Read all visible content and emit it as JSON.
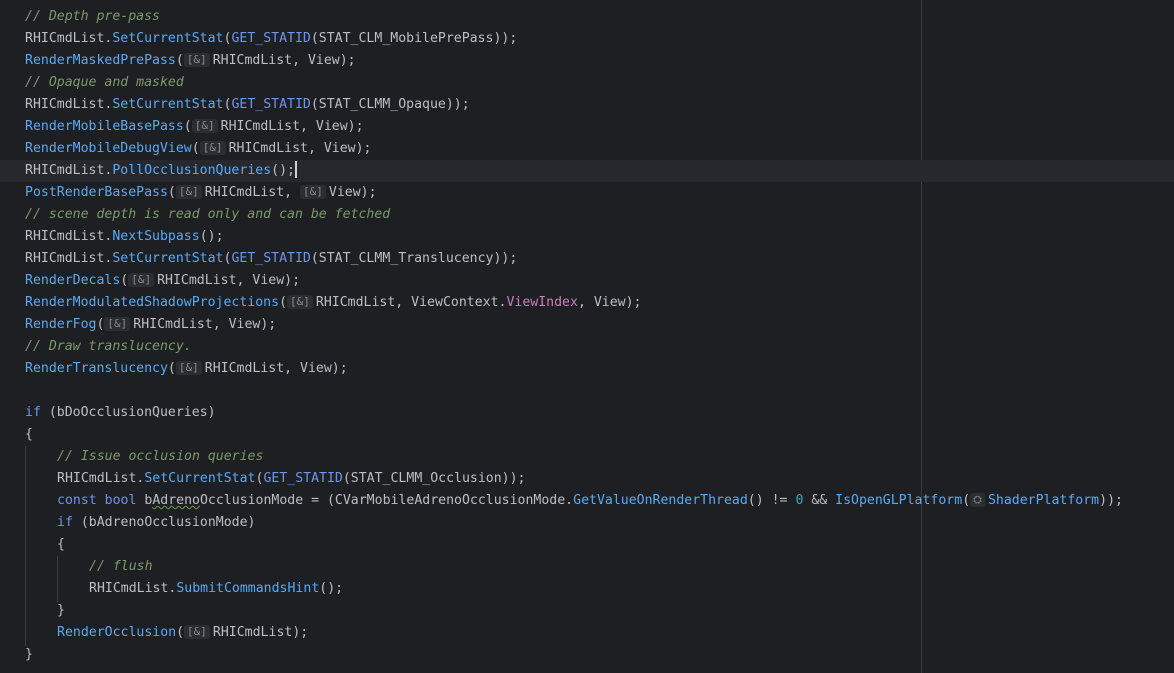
{
  "editor": {
    "hints": {
      "ref": "[&]",
      "shader": "⛭"
    },
    "lines": {
      "l1": "// Depth pre-pass",
      "l2": [
        "RHICmdList.",
        "SetCurrentStat",
        "(",
        "GET_STATID",
        "(STAT_CLM_MobilePrePass));"
      ],
      "l3": [
        "RenderMaskedPrePass",
        "(",
        "RHICmdList, View);"
      ],
      "l4": "// Opaque and masked",
      "l5": [
        "RHICmdList.",
        "SetCurrentStat",
        "(",
        "GET_STATID",
        "(STAT_CLMM_Opaque));"
      ],
      "l6": [
        "RenderMobileBasePass",
        "(",
        "RHICmdList, View);"
      ],
      "l7": [
        "RenderMobileDebugView",
        "(",
        "RHICmdList, View);"
      ],
      "l8": [
        "RHICmdList.",
        "PollOcclusionQueries",
        "();"
      ],
      "l9": [
        "PostRenderBasePass",
        "(",
        "RHICmdList, ",
        "View);"
      ],
      "l10": "// scene depth is read only and can be fetched",
      "l11": [
        "RHICmdList.",
        "NextSubpass",
        "();"
      ],
      "l12": [
        "RHICmdList.",
        "SetCurrentStat",
        "(",
        "GET_STATID",
        "(STAT_CLMM_Translucency));"
      ],
      "l13": [
        "RenderDecals",
        "(",
        "RHICmdList, View);"
      ],
      "l14": [
        "RenderModulatedShadowProjections",
        "(",
        "RHICmdList, ViewContext.",
        "ViewIndex",
        ", View);"
      ],
      "l15": [
        "RenderFog",
        "(",
        "RHICmdList, View);"
      ],
      "l16": "// Draw translucency.",
      "l17": [
        "RenderTranslucency",
        "(",
        "RHICmdList, View);"
      ],
      "l19": [
        "if",
        " (bDoOcclusionQueries)"
      ],
      "l20": "{",
      "l21": "// Issue occlusion queries",
      "l22": [
        "RHICmdList.",
        "SetCurrentStat",
        "(",
        "GET_STATID",
        "(STAT_CLMM_Occlusion));"
      ],
      "l23": [
        "const",
        " ",
        "bool",
        " b",
        "Adreno",
        "OcclusionMode = (CVarMobileAdrenoOcclusionMode.",
        "GetValueOnRenderThread",
        "() != ",
        "0",
        " && ",
        "IsOpenGLPlatform",
        "(",
        "ShaderPlatform",
        "));"
      ],
      "l24": [
        "if",
        " (bAdrenoOcclusionMode)"
      ],
      "l25": "{",
      "l26": "// flush",
      "l27": [
        "RHICmdList.",
        "SubmitCommandsHint",
        "();"
      ],
      "l28": "}",
      "l29": [
        "RenderOcclusion",
        "(",
        "RHICmdList);"
      ],
      "l30": "}"
    }
  }
}
